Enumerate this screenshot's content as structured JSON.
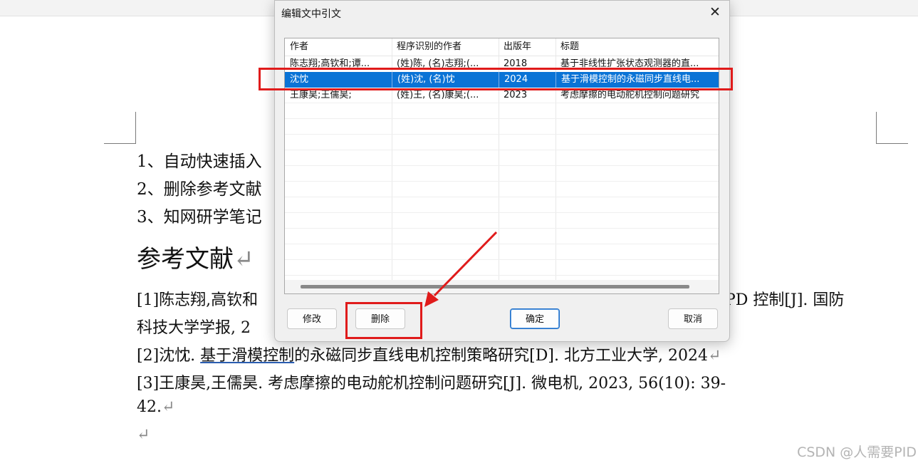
{
  "document": {
    "lines": [
      "1、自动快速插入",
      "2、删除参考文献",
      "3、知网研学笔记"
    ],
    "heading": "参考文献",
    "para_mark": "↵",
    "references": {
      "r1_part1": "[1]陈志翔,高钦和",
      "r1_part2": "PD 控制[J]. 国防",
      "r1_line2": "科技大学学报, 2",
      "r2_prefix": "[2]沈忱. ",
      "r2_link": "基于滑模控制",
      "r2_rest": "的永磁同步直线电机控制策略研究[D]. 北方工业大学, 2024",
      "r3_line1": "[3]王康昊,王儒昊. 考虑摩擦的电动舵机控制问题研究[J]. 微电机, 2023, 56(10): 39-",
      "r3_line2": "42."
    }
  },
  "watermark": "CSDN @人需要PID",
  "dialog": {
    "title": "编辑文中引文",
    "close": "✕",
    "columns": [
      "作者",
      "程序识别的作者",
      "出版年",
      "标题"
    ],
    "rows": [
      {
        "author": "陈志翔;高钦和;谭...",
        "recognized": "(姓)陈, (名)志翔;(...",
        "year": "2018",
        "title": "基于非线性扩张状态观测器的直..."
      },
      {
        "author": "沈忱",
        "recognized": "(姓)沈, (名)忱",
        "year": "2024",
        "title": "基于滑模控制的永磁同步直线电..."
      },
      {
        "author": "王康昊;王儒昊;",
        "recognized": "(姓)王, (名)康昊;(...",
        "year": "2023",
        "title": "考虑摩擦的电动舵机控制问题研究"
      }
    ],
    "selected_row": 1,
    "buttons": {
      "modify": "修改",
      "delete": "删除",
      "ok": "确定",
      "cancel": "取消"
    }
  },
  "colors": {
    "selection": "#0a73d6",
    "annotation": "#e01b1b"
  }
}
